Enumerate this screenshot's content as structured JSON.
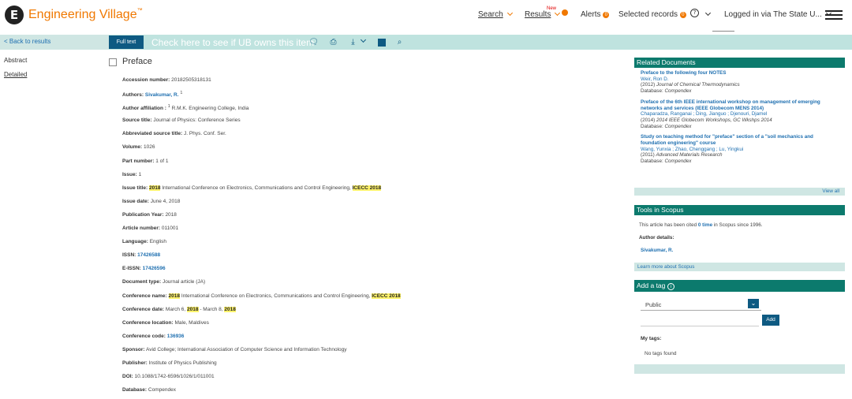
{
  "header": {
    "logo_mark": "E",
    "logo_text": "Engineering Village",
    "logo_tm": "™",
    "nav_search": "Search",
    "nav_results": "Results",
    "new_tag": "New",
    "results_badge": "",
    "nav_alerts": "Alerts",
    "alerts_badge": "0",
    "nav_selected": "Selected records",
    "selected_badge": "0",
    "help_glyph": "?",
    "logged_in": "Logged in via The State U...",
    "icons": [
      "help-icon",
      "chevron-down-icon",
      "hamburger-menu-icon"
    ],
    "accent": "#f07800"
  },
  "toolbar": {
    "back": "< Back to results",
    "fulltext": "Full text",
    "check_link": "Check here to see if UB owns this item",
    "icons": [
      "comment-icon",
      "print-icon",
      "download-icon",
      "folder-icon",
      "search-icon"
    ],
    "icon_glyphs": {
      "comment": "🗨",
      "print": "⎙",
      "download": "⤓",
      "search": "⌕"
    },
    "color": "#0e5a82"
  },
  "leftnav": {
    "abstract": "Abstract",
    "detailed": "Detailed"
  },
  "doc": {
    "title": "Preface",
    "fields": {
      "accession_label": "Accession number:",
      "accession": "20182505318131",
      "authors_label": "Authors:",
      "authors": "Sivakumar, R.",
      "authors_sup": "1",
      "affil_label": "Author affiliation :",
      "affil_sup": "1",
      "affil": "R.M.K. Engineering College, India",
      "source_label": "Source title:",
      "source": "Journal of Physics: Conference Series",
      "abbr_label": "Abbreviated source title:",
      "abbr": "J. Phys. Conf. Ser.",
      "volume_label": "Volume:",
      "volume": "1026",
      "part_label": "Part number:",
      "part": "1 of 1",
      "issue_label": "Issue:",
      "issue": "1",
      "issue_title_label": "Issue title:",
      "issue_title_a": "2018",
      "issue_title_b": "International Conference on Electronics, Communications and Control Engineering,",
      "issue_title_c": "ICECC 2018",
      "issue_date_label": "Issue date:",
      "issue_date": "June 4, 2018",
      "pubyear_label": "Publication Year:",
      "pubyear": "2018",
      "article_label": "Article number:",
      "article": "011001",
      "lang_label": "Language:",
      "lang": "English",
      "issn_label": "ISSN:",
      "issn": "17426588",
      "eissn_label": "E-ISSN:",
      "eissn": "17426596",
      "doctype_label": "Document type:",
      "doctype": "Journal article (JA)",
      "confname_label": "Conference name:",
      "confname_a": "2018",
      "confname_b": "International Conference on Electronics, Communications and Control Engineering,",
      "confname_c": "ICECC 2018",
      "confdate_label": "Conference date:",
      "confdate_a": "March 6,",
      "confdate_b": "2018",
      "confdate_c": "- March 8,",
      "confdate_d": "2018",
      "confloc_label": "Conference location:",
      "confloc": "Male, Maldives",
      "confcode_label": "Conference code:",
      "confcode": "136936",
      "sponsor_label": "Sponsor:",
      "sponsor": "Avid College; International Association of Computer Science and Information Technology",
      "publisher_label": "Publisher:",
      "publisher": "Institute of Physics Publishing",
      "doi_label": "DOI:",
      "doi": "10.1088/1742-6596/1026/1/011001",
      "db_label": "Database:",
      "db": "Compendex"
    }
  },
  "related": {
    "heading": "Related Documents",
    "items": [
      {
        "title": "Preface to the following four NOTES",
        "authors": "Weir, Ron D.",
        "pub_a": "(2012)",
        "pub_b": "Journal of Chemical Thermodynamics",
        "db_label": "Database:",
        "db": "Compendex"
      },
      {
        "title": "Preface of the 6th IEEE international workshop on management of emerging networks and services (IEEE Globecom MENS 2014)",
        "authors": "Chaparadza, Ranganai ; Ding, Jianguo ; Djenouri, Djamel",
        "pub_a": "(2014)",
        "pub_b": "2014 IEEE Globecom Workshops, GC Wkshps 2014",
        "db_label": "Database:",
        "db": "Compendex"
      },
      {
        "title": "Study on teaching method for \"preface\" section of a \"soil mechanics and foundation engineering\" course",
        "authors": "Wang, Yunxia ; Zhao, Chenggang ; Lu, Yingkui",
        "pub_a": "(2011)",
        "pub_b": "Advanced Materials Research",
        "db_label": "Database:",
        "db": "Compendex"
      }
    ],
    "view_all": "View all"
  },
  "scopus": {
    "heading": "Tools in Scopus",
    "cited_a": "This article has been cited",
    "cited_b": "0 time",
    "cited_c": "in Scopus since 1996.",
    "author_details": "Author details:",
    "author": "Sivakumar, R.",
    "learn_more": "Learn more about Scopus"
  },
  "tags": {
    "heading": "Add a tag",
    "info_glyph": "i",
    "select_value": "Public",
    "add": "Add",
    "my_tags": "My tags:",
    "no_tags": "No tags found"
  },
  "colors": {
    "teal": "#0c7a6d",
    "light_teal": "#cfe6e3",
    "link": "#1e6fb0",
    "highlight": "#fff36b"
  }
}
